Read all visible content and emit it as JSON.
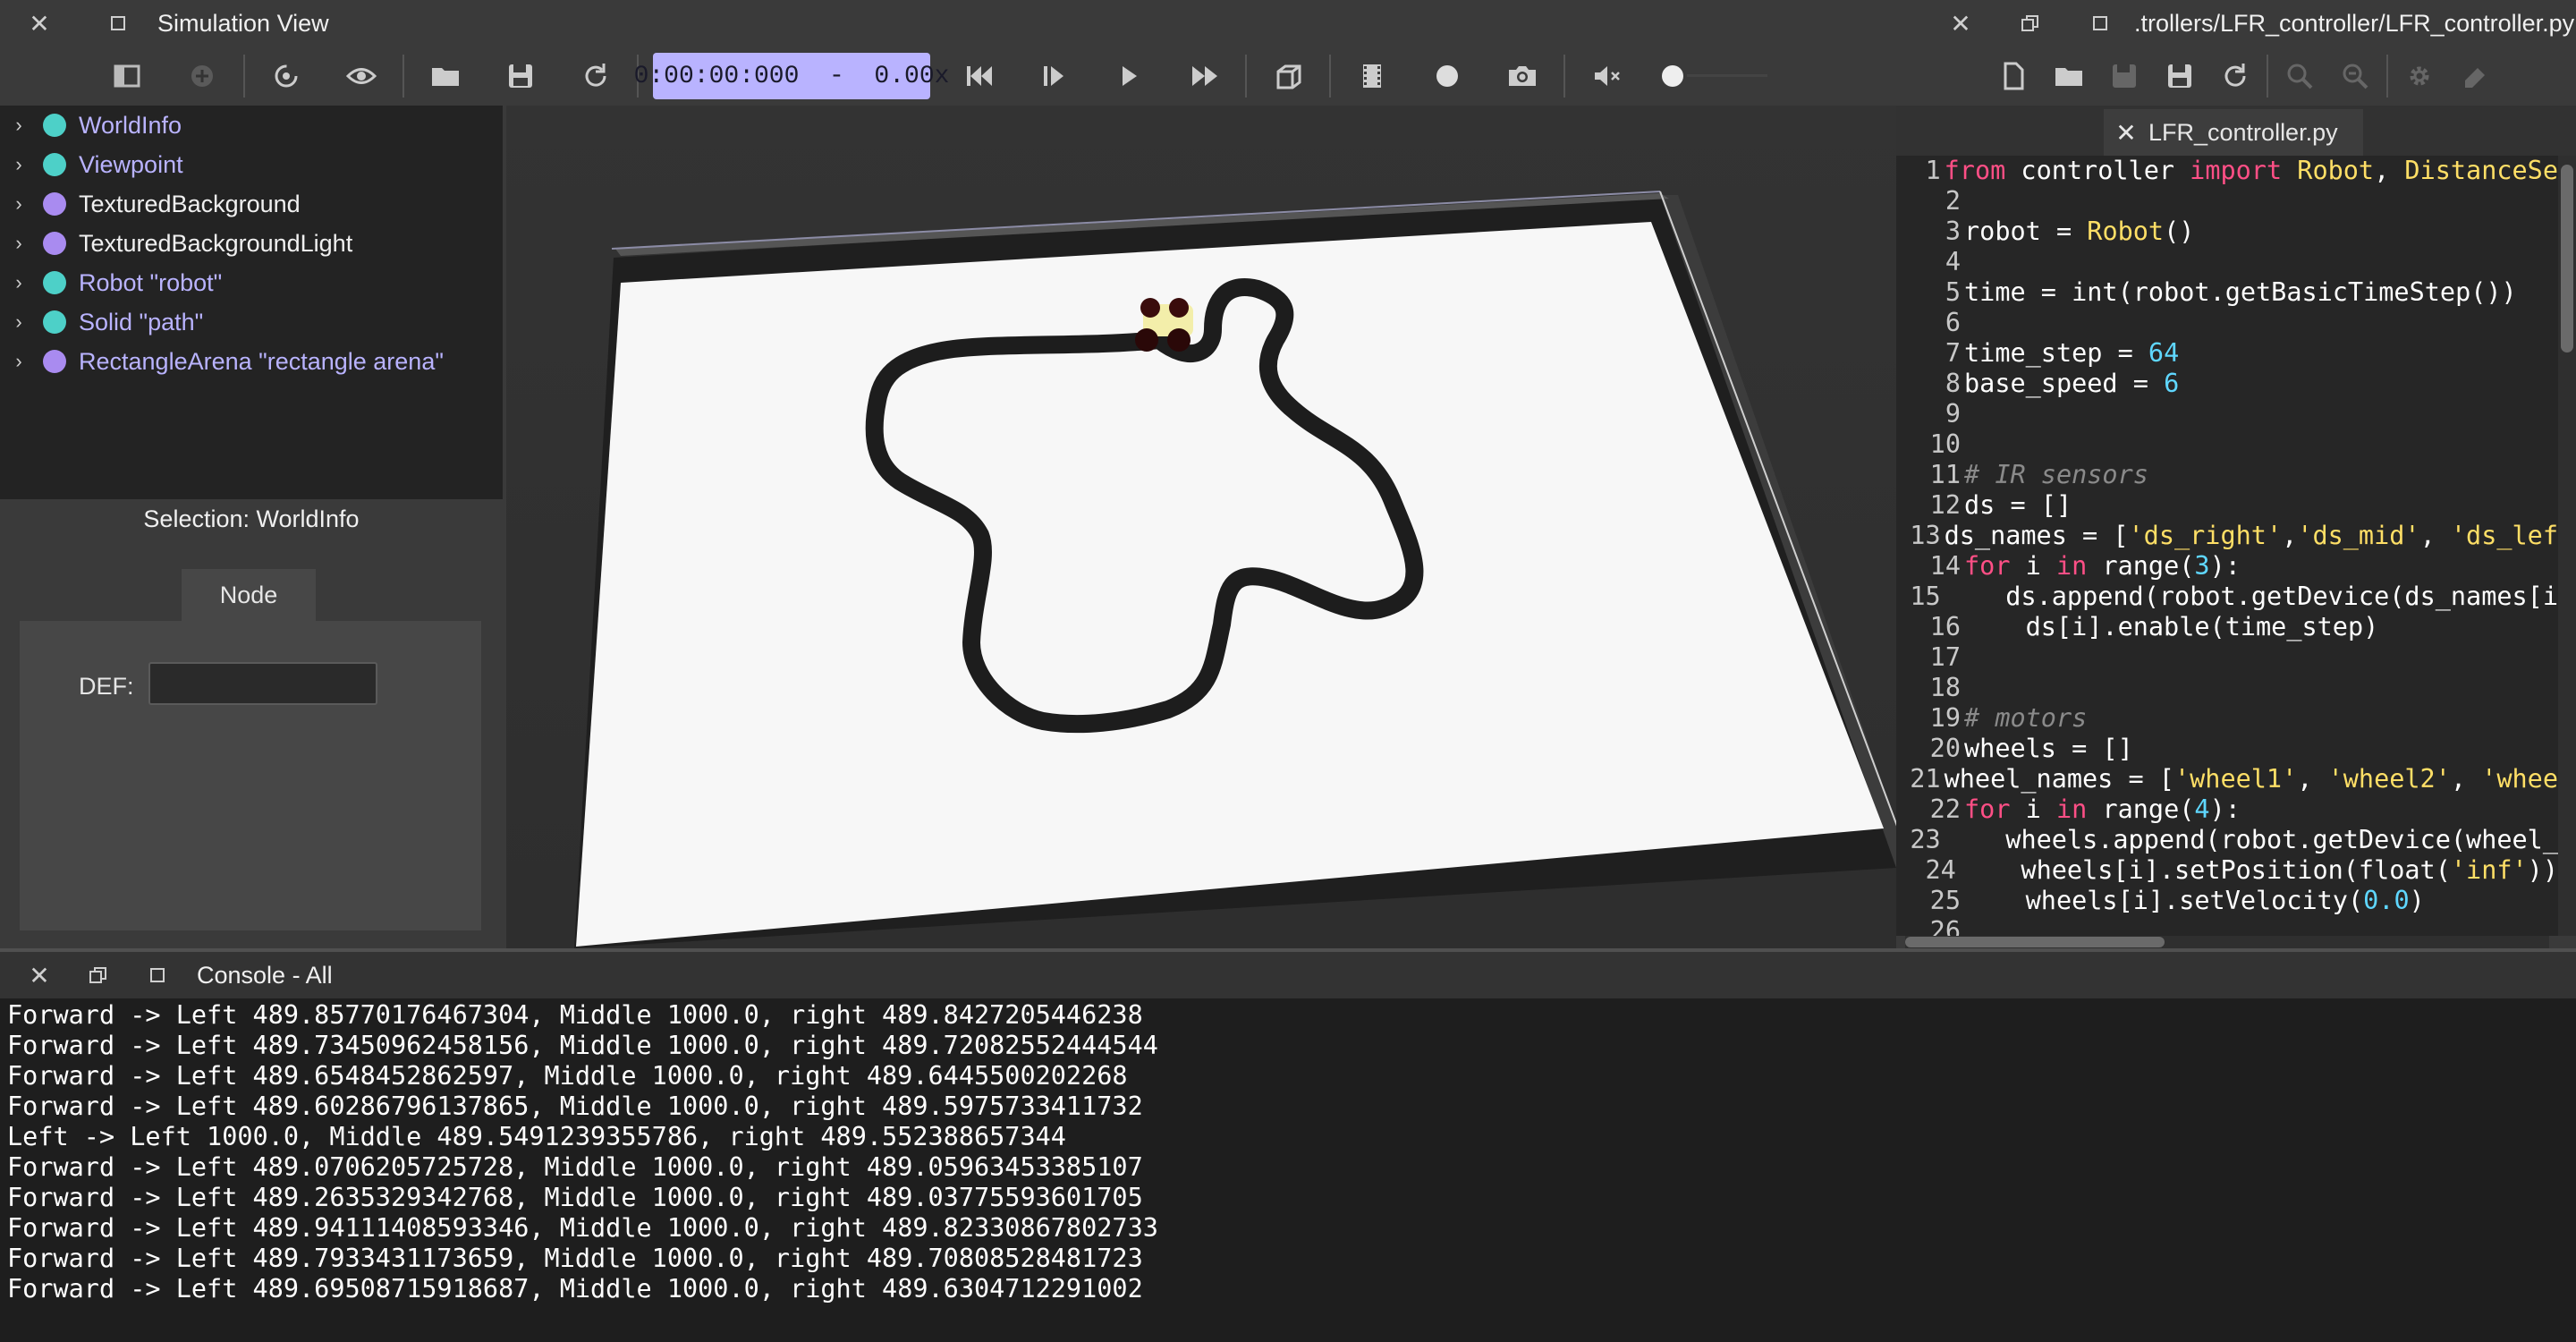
{
  "sim": {
    "title": "Simulation View",
    "time": "0:00:00:000  -  0.00x",
    "toolbar": [
      "toggle-scene-tree-icon",
      "add-node-icon",
      "reload-world-icon",
      "view-icon",
      "open-world-icon",
      "save-world-icon",
      "revert-icon",
      "fast-backward-icon",
      "step-icon",
      "play-icon",
      "fast-forward-icon",
      "rendering-icon",
      "record-movie-icon",
      "record-icon",
      "screenshot-icon",
      "mute-icon",
      "volume-icon"
    ]
  },
  "scene_tree": [
    {
      "label": "WorldInfo",
      "color": "#4dd0c8",
      "text_color": "#b9b3ff"
    },
    {
      "label": "Viewpoint",
      "color": "#4dd0c8",
      "text_color": "#b9b3ff"
    },
    {
      "label": "TexturedBackground",
      "color": "#a98bf0",
      "text_color": "#f0f0f0"
    },
    {
      "label": "TexturedBackgroundLight",
      "color": "#a98bf0",
      "text_color": "#f0f0f0"
    },
    {
      "label": "Robot \"robot\"",
      "color": "#4dd0c8",
      "text_color": "#b9b3ff"
    },
    {
      "label": "Solid \"path\"",
      "color": "#4dd0c8",
      "text_color": "#b9b3ff"
    },
    {
      "label": "RectangleArena \"rectangle arena\"",
      "color": "#a98bf0",
      "text_color": "#b9b3ff"
    }
  ],
  "field_editor": {
    "selection": "Selection: WorldInfo",
    "tab": "Node",
    "def_label": "DEF:",
    "def_value": ""
  },
  "editor": {
    "title": ".trollers/LFR_controller/LFR_controller.py",
    "file_tab": "LFR_controller.py",
    "lines": [
      {
        "n": "1",
        "tokens": [
          [
            "kw",
            "from"
          ],
          [
            "code",
            " controller "
          ],
          [
            "kw",
            "import"
          ],
          [
            "cls",
            " Robot"
          ],
          [
            "code",
            ", "
          ],
          [
            "cls",
            "DistanceSe"
          ]
        ]
      },
      {
        "n": "2",
        "tokens": []
      },
      {
        "n": "3",
        "tokens": [
          [
            "code",
            "robot = "
          ],
          [
            "cls",
            "Robot"
          ],
          [
            "code",
            "()"
          ]
        ]
      },
      {
        "n": "4",
        "tokens": []
      },
      {
        "n": "5",
        "tokens": [
          [
            "code",
            "time = int(robot.getBasicTimeStep())"
          ]
        ]
      },
      {
        "n": "6",
        "tokens": []
      },
      {
        "n": "7",
        "tokens": [
          [
            "code",
            "time_step = "
          ],
          [
            "num",
            "64"
          ]
        ]
      },
      {
        "n": "8",
        "tokens": [
          [
            "code",
            "base_speed = "
          ],
          [
            "num",
            "6"
          ]
        ]
      },
      {
        "n": "9",
        "tokens": []
      },
      {
        "n": "10",
        "tokens": []
      },
      {
        "n": "11",
        "tokens": [
          [
            "com",
            "# IR sensors"
          ]
        ]
      },
      {
        "n": "12",
        "tokens": [
          [
            "code",
            "ds = []"
          ]
        ]
      },
      {
        "n": "13",
        "tokens": [
          [
            "code",
            "ds_names = ["
          ],
          [
            "str",
            "'ds_right'"
          ],
          [
            "code",
            ","
          ],
          [
            "str",
            "'ds_mid'"
          ],
          [
            "code",
            ", "
          ],
          [
            "str",
            "'ds_lef"
          ]
        ]
      },
      {
        "n": "14",
        "tokens": [
          [
            "kw",
            "for"
          ],
          [
            "code",
            " i "
          ],
          [
            "kw",
            "in"
          ],
          [
            "code",
            " range("
          ],
          [
            "num",
            "3"
          ],
          [
            "code",
            "):"
          ]
        ]
      },
      {
        "n": "15",
        "tokens": [
          [
            "code",
            "    ds.append(robot.getDevice(ds_names[i"
          ]
        ]
      },
      {
        "n": "16",
        "tokens": [
          [
            "code",
            "    ds[i].enable(time_step)"
          ]
        ]
      },
      {
        "n": "17",
        "tokens": []
      },
      {
        "n": "18",
        "tokens": []
      },
      {
        "n": "19",
        "tokens": [
          [
            "com",
            "# motors"
          ]
        ]
      },
      {
        "n": "20",
        "tokens": [
          [
            "code",
            "wheels = []"
          ]
        ]
      },
      {
        "n": "21",
        "tokens": [
          [
            "code",
            "wheel_names = ["
          ],
          [
            "str",
            "'wheel1'"
          ],
          [
            "code",
            ", "
          ],
          [
            "str",
            "'wheel2'"
          ],
          [
            "code",
            ", "
          ],
          [
            "str",
            "'whee"
          ]
        ]
      },
      {
        "n": "22",
        "tokens": [
          [
            "kw",
            "for"
          ],
          [
            "code",
            " i "
          ],
          [
            "kw",
            "in"
          ],
          [
            "code",
            " range("
          ],
          [
            "num",
            "4"
          ],
          [
            "code",
            "):"
          ]
        ]
      },
      {
        "n": "23",
        "tokens": [
          [
            "code",
            "    wheels.append(robot.getDevice(wheel_"
          ]
        ]
      },
      {
        "n": "24",
        "tokens": [
          [
            "code",
            "    wheels[i].setPosition(float("
          ],
          [
            "str",
            "'inf'"
          ],
          [
            "code",
            "))"
          ]
        ]
      },
      {
        "n": "25",
        "tokens": [
          [
            "code",
            "    wheels[i].setVelocity("
          ],
          [
            "num",
            "0.0"
          ],
          [
            "code",
            ")"
          ]
        ]
      },
      {
        "n": "26",
        "tokens": []
      }
    ]
  },
  "console": {
    "title": "Console - All",
    "lines": [
      "Forward -> Left 489.85770176467304, Middle 1000.0, right 489.8427205446238",
      "Forward -> Left 489.73450962458156, Middle 1000.0, right 489.72082552444544",
      "Forward -> Left 489.6548452862597, Middle 1000.0, right 489.6445500202268",
      "Forward -> Left 489.60286796137865, Middle 1000.0, right 489.5975733411732",
      "Left -> Left 1000.0, Middle 489.5491239355786, right 489.552388657344",
      "Forward -> Left 489.0706205725728, Middle 1000.0, right 489.05963453385107",
      "Forward -> Left 489.2635329342768, Middle 1000.0, right 489.03775593601705",
      "Forward -> Left 489.94111408593346, Middle 1000.0, right 489.82330867802733",
      "Forward -> Left 489.7933431173659, Middle 1000.0, right 489.70808528481723",
      "Forward -> Left 489.69508715918687, Middle 1000.0, right 489.6304712291002"
    ]
  }
}
